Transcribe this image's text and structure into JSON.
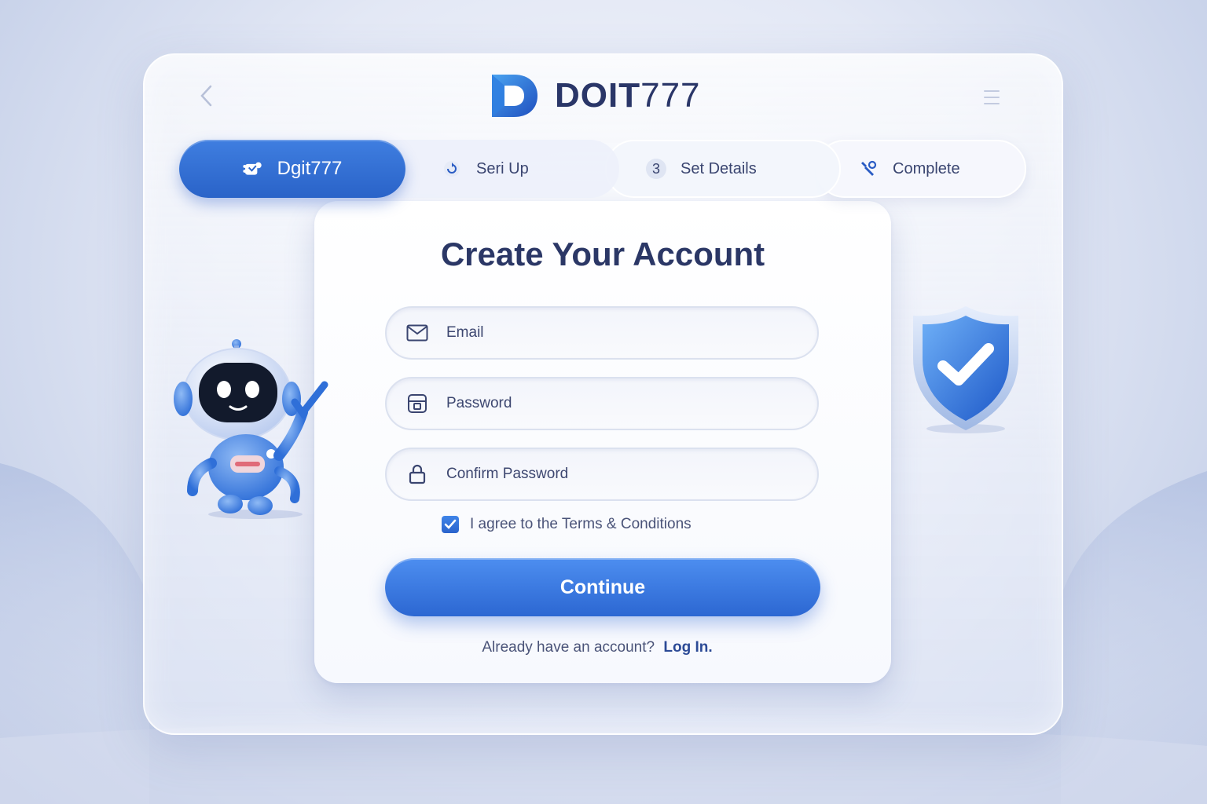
{
  "header": {
    "logo_text_bold": "DOIT",
    "logo_text_light": "777"
  },
  "stepper": {
    "steps": [
      {
        "label": "Dgit777",
        "icon": "brand-icon",
        "active": true
      },
      {
        "label": "Seri Up",
        "icon": "refresh-icon"
      },
      {
        "label": "Set Details",
        "number": "3"
      },
      {
        "label": "Complete",
        "icon": "tools-icon"
      }
    ]
  },
  "form": {
    "title": "Create Your Account",
    "email_placeholder": "Email",
    "password_placeholder": "Password",
    "confirm_placeholder": "Confirm Password",
    "agree_label": "I agree to the Terms & Conditions",
    "agree_checked": true,
    "continue_label": "Continue",
    "login_prompt": "Already have an account?",
    "login_link": "Log In."
  },
  "colors": {
    "primary": "#2c67d2",
    "title": "#2b3766",
    "background": "#e3e8f5"
  }
}
